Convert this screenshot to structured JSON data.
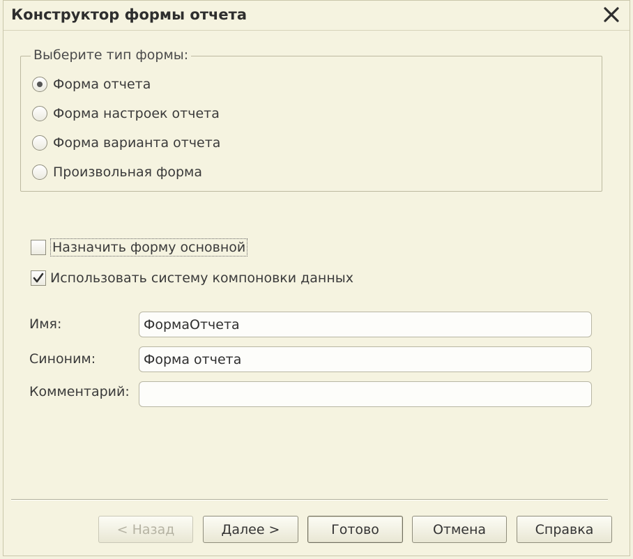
{
  "window": {
    "title": "Конструктор формы отчета"
  },
  "group": {
    "legend": "Выберите тип формы:",
    "options": [
      {
        "label": "Форма отчета",
        "checked": true
      },
      {
        "label": "Форма настроек отчета",
        "checked": false
      },
      {
        "label": "Форма варианта отчета",
        "checked": false
      },
      {
        "label": "Произвольная форма",
        "checked": false
      }
    ]
  },
  "checks": {
    "set_main": {
      "label": "Назначить форму основной",
      "checked": false
    },
    "use_dcs": {
      "label": "Использовать систему компоновки данных",
      "checked": true
    }
  },
  "fields": {
    "name": {
      "label": "Имя:",
      "value": "ФормаОтчета"
    },
    "synonym": {
      "label": "Синоним:",
      "value": "Форма отчета"
    },
    "comment": {
      "label": "Комментарий:",
      "value": ""
    }
  },
  "buttons": {
    "back": "< Назад",
    "next": "Далее >",
    "finish": "Готово",
    "cancel": "Отмена",
    "help": "Справка"
  }
}
